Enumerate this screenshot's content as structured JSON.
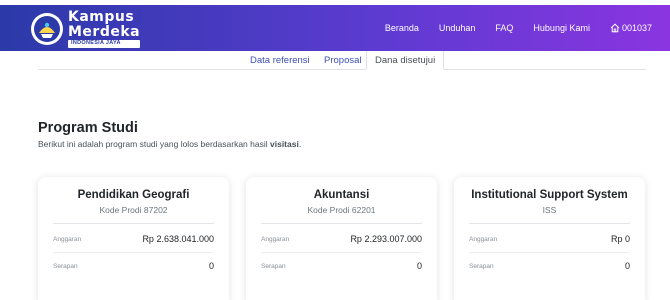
{
  "brand": {
    "line1": "Kampus",
    "line2": "Merdeka",
    "subline": "INDONESIA JAYA"
  },
  "nav": {
    "links": [
      "Beranda",
      "Unduhan",
      "FAQ",
      "Hubungi Kami"
    ],
    "user_label": "001037"
  },
  "tabs": [
    "Data referensi",
    "Proposal",
    "Dana disetujui"
  ],
  "active_tab": "Dana disetujui",
  "section": {
    "title": "Program Studi",
    "description_prefix": "Berikut ini adalah program studi yang lolos berdasarkan hasil ",
    "description_bold": "visitasi",
    "description_suffix": "."
  },
  "cards": [
    {
      "name": "Pendidikan Geografi",
      "code": "Kode Prodi 87202",
      "anggaran_label": "Anggaran",
      "anggaran": "Rp 2.638.041.000",
      "serapan_label": "Serapan",
      "serapan": "0"
    },
    {
      "name": "Akuntansi",
      "code": "Kode Prodi 62201",
      "anggaran_label": "Anggaran",
      "anggaran": "Rp 2.293.007.000",
      "serapan_label": "Serapan",
      "serapan": "0"
    },
    {
      "name": "Institutional Support System",
      "code": "ISS",
      "anggaran_label": "Anggaran",
      "anggaran": "Rp 0",
      "serapan_label": "Serapan",
      "serapan": "0"
    }
  ],
  "colors": {
    "navbar_gradient_start": "#2b3aa8",
    "navbar_gradient_end": "#8a35e0",
    "tab_link": "#3f51b5"
  },
  "icons": {
    "logo": "kampus-merdeka-emblem",
    "home": "home-icon"
  }
}
